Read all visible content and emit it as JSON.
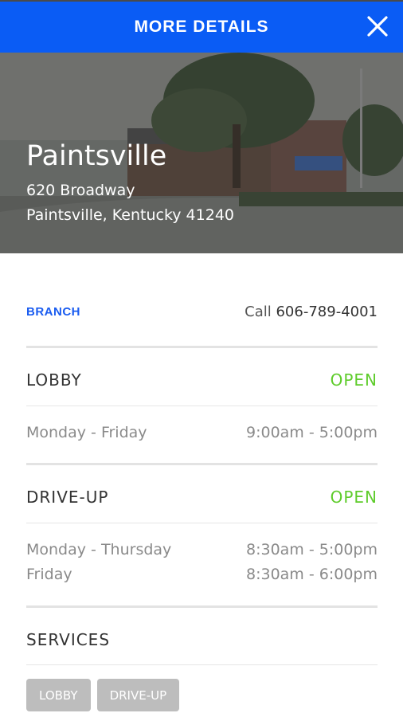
{
  "header": {
    "title": "MORE DETAILS",
    "close_icon": "close-icon"
  },
  "hero": {
    "name": "Paintsville",
    "address_line1": "620 Broadway",
    "address_line2": "Paintsville, Kentucky 41240"
  },
  "branch": {
    "label": "BRANCH",
    "call_prefix": "Call",
    "phone": "606-789-4001"
  },
  "lobby": {
    "title": "LOBBY",
    "status": "OPEN",
    "hours": [
      {
        "days": "Monday - Friday",
        "time": "9:00am - 5:00pm"
      }
    ]
  },
  "drive_up": {
    "title": "DRIVE-UP",
    "status": "OPEN",
    "hours": [
      {
        "days": "Monday - Thursday",
        "time": "8:30am - 5:00pm"
      },
      {
        "days": "Friday",
        "time": "8:30am - 6:00pm"
      }
    ]
  },
  "services": {
    "title": "SERVICES",
    "chips": [
      "LOBBY",
      "DRIVE-UP"
    ]
  },
  "colors": {
    "header_bg": "#0a5cf5",
    "branch_label": "#1a5cf0",
    "open_status": "#5fcc2c",
    "chip_bg": "#bdbdbd"
  }
}
